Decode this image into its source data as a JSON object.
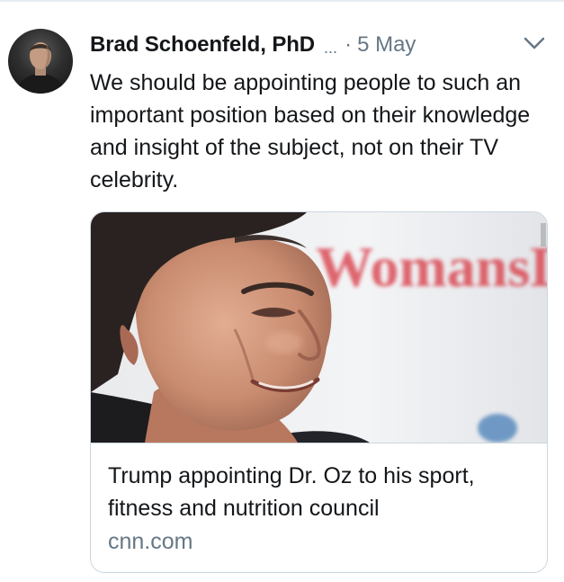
{
  "tweet": {
    "author_name": "Brad Schoenfeld, PhD",
    "author_truncation": "...",
    "separator": "·",
    "timestamp": "5 May",
    "text": "We should be appointing people to such an important position based on their knowledge and insight of the subject, not on their TV celebrity.",
    "avatar_icon": "avatar-photo",
    "menu_icon": "chevron-down-icon"
  },
  "card": {
    "title": "Trump appointing Dr. Oz to his sport, fitness and nutrition council",
    "domain": "cnn.com",
    "image_logo_text": "WomansDay",
    "image_icon": "portrait-photo"
  },
  "colors": {
    "text_primary": "#14171a",
    "text_secondary": "#657786",
    "border": "#ccd6dd",
    "divider": "#e6ecf0",
    "logo_red": "#d8343f"
  }
}
